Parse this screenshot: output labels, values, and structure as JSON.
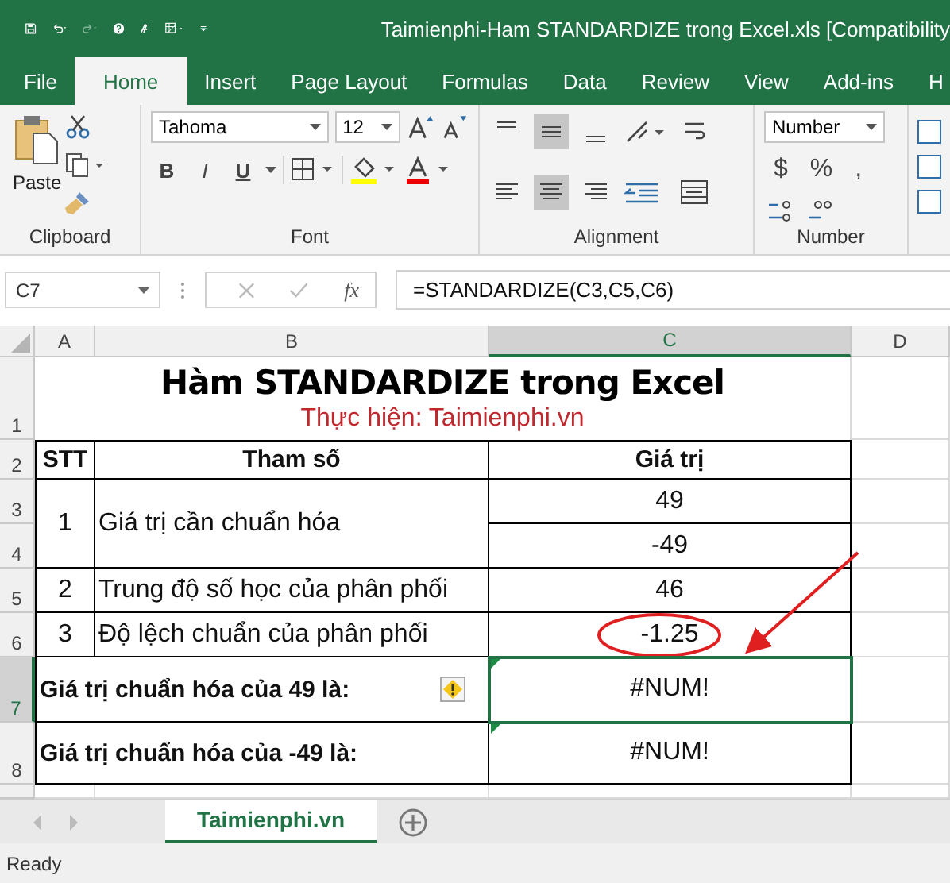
{
  "window": {
    "title": "Taimienphi-Ham STANDARDIZE trong Excel.xls  [Compatibility"
  },
  "tabs": [
    {
      "label": "File",
      "selected": false
    },
    {
      "label": "Home",
      "selected": true
    },
    {
      "label": "Insert",
      "selected": false
    },
    {
      "label": "Page Layout",
      "selected": false
    },
    {
      "label": "Formulas",
      "selected": false
    },
    {
      "label": "Data",
      "selected": false
    },
    {
      "label": "Review",
      "selected": false
    },
    {
      "label": "View",
      "selected": false
    },
    {
      "label": "Add-ins",
      "selected": false
    },
    {
      "label": "H",
      "selected": false
    }
  ],
  "ribbon": {
    "paste_label": "Paste",
    "font_name": "Tahoma",
    "font_size": "12",
    "format_buttons": [
      "B",
      "I",
      "U"
    ],
    "number_format": "Number",
    "number_buttons": [
      "$",
      "%",
      ","
    ],
    "groups": [
      "Clipboard",
      "Font",
      "Alignment",
      "Number"
    ]
  },
  "formula_bar": {
    "name_box": "C7",
    "fx": "fx",
    "formula": "=STANDARDIZE(C3,C5,C6)"
  },
  "sheet": {
    "columns": [
      {
        "label": "A",
        "selected": false
      },
      {
        "label": "B",
        "selected": false
      },
      {
        "label": "C",
        "selected": true
      },
      {
        "label": "D",
        "selected": false
      }
    ],
    "rows": [
      {
        "label": "1",
        "selected": false
      },
      {
        "label": "2",
        "selected": false
      },
      {
        "label": "3",
        "selected": false
      },
      {
        "label": "4",
        "selected": false
      },
      {
        "label": "5",
        "selected": false
      },
      {
        "label": "6",
        "selected": false
      },
      {
        "label": "7",
        "selected": true
      },
      {
        "label": "8",
        "selected": false
      }
    ],
    "title": "Hàm STANDARDIZE trong Excel",
    "subtitle": "Thực hiện: Taimienphi.vn",
    "header": [
      "STT",
      "Tham số",
      "Giá trị"
    ],
    "data": [
      {
        "stt": "1",
        "name": "Giá trị cần chuẩn hóa",
        "values": [
          "49",
          "-49"
        ]
      },
      {
        "stt": "2",
        "name": "Trung độ số học của phân phối",
        "values": [
          "46"
        ]
      },
      {
        "stt": "3",
        "name": "Độ lệch chuẩn của phân phối",
        "values": [
          "-1.25"
        ],
        "circled": true
      }
    ],
    "results": [
      {
        "label": "Giá trị chuẩn hóa của 49 là:",
        "value": "#NUM!",
        "selected": true,
        "warning": true
      },
      {
        "label": "Giá trị chuẩn hóa của -49 là:",
        "value": "#NUM!",
        "selected": false,
        "warning": false
      }
    ]
  },
  "sheet_tabs": [
    {
      "label": "Taimienphi.vn",
      "selected": true
    }
  ],
  "status_bar": {
    "text": "Ready"
  }
}
